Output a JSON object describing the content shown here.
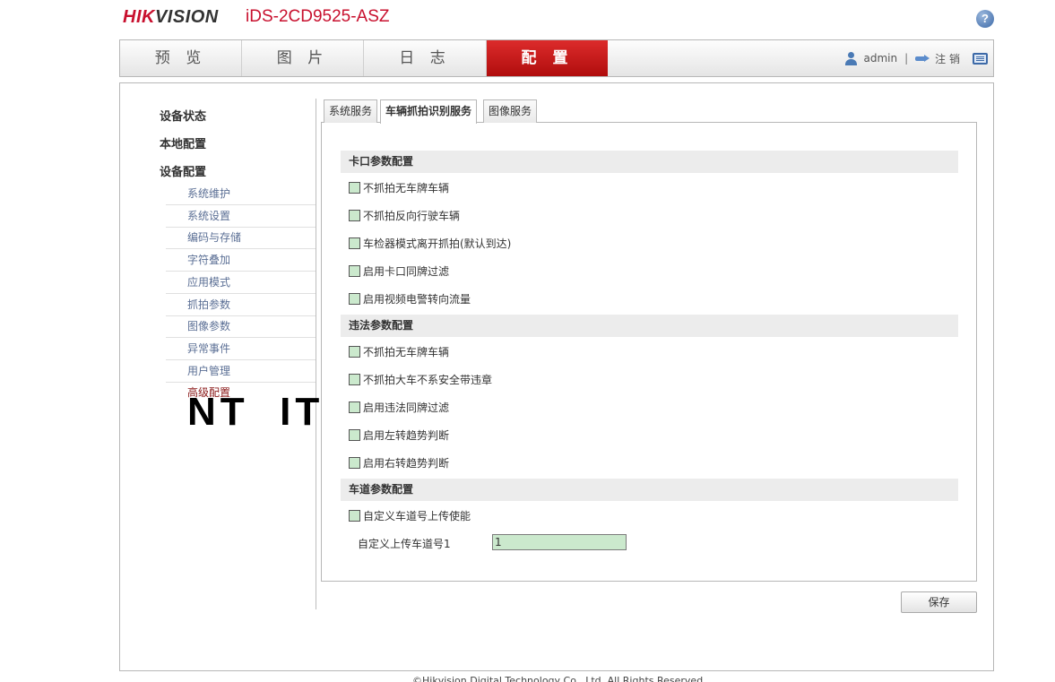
{
  "header": {
    "brand_hik": "HIK",
    "brand_vision": "VISION",
    "model": "iDS-2CD9525-ASZ",
    "help_label": "?"
  },
  "nav": {
    "tabs": [
      {
        "label": "预 览"
      },
      {
        "label": "图 片"
      },
      {
        "label": "日 志"
      },
      {
        "label": "配 置"
      }
    ],
    "active_index": 3,
    "user": "admin",
    "separator": "|",
    "logout": "注 销"
  },
  "sidebar": {
    "groups": [
      "设备状态",
      "本地配置",
      "设备配置"
    ],
    "items": [
      {
        "label": "系统维护"
      },
      {
        "label": "系统设置"
      },
      {
        "label": "编码与存储"
      },
      {
        "label": "字符叠加"
      },
      {
        "label": "应用模式"
      },
      {
        "label": "抓拍参数"
      },
      {
        "label": "图像参数"
      },
      {
        "label": "异常事件"
      },
      {
        "label": "用户管理"
      },
      {
        "label": "高级配置"
      }
    ],
    "current_item": "高级配置"
  },
  "overlay_text": "NT  ITS",
  "tabs": [
    {
      "label": "系统服务"
    },
    {
      "label": "车辆抓拍识别服务"
    },
    {
      "label": "图像服务"
    }
  ],
  "active_tab": "车辆抓拍识别服务",
  "sections": [
    {
      "title": "卡口参数配置",
      "options": [
        {
          "label": "不抓拍无车牌车辆",
          "checked": false
        },
        {
          "label": "不抓拍反向行驶车辆",
          "checked": false
        },
        {
          "label": "车检器模式离开抓拍(默认到达)",
          "checked": false
        },
        {
          "label": "启用卡口同牌过滤",
          "checked": false
        },
        {
          "label": "启用视频电警转向流量",
          "checked": false
        }
      ]
    },
    {
      "title": "违法参数配置",
      "options": [
        {
          "label": "不抓拍无车牌车辆",
          "checked": false
        },
        {
          "label": "不抓拍大车不系安全带违章",
          "checked": false
        },
        {
          "label": "启用违法同牌过滤",
          "checked": false
        },
        {
          "label": "启用左转趋势判断",
          "checked": false
        },
        {
          "label": "启用右转趋势判断",
          "checked": false
        }
      ]
    },
    {
      "title": "车道参数配置",
      "options": [
        {
          "label": "自定义车道号上传使能",
          "checked": false
        }
      ]
    }
  ],
  "lane_field": {
    "label": "自定义上传车道号1",
    "value": "1"
  },
  "save_label": "保存",
  "footer": "©Hikvision Digital Technology Co., Ltd. All Rights Reserved."
}
